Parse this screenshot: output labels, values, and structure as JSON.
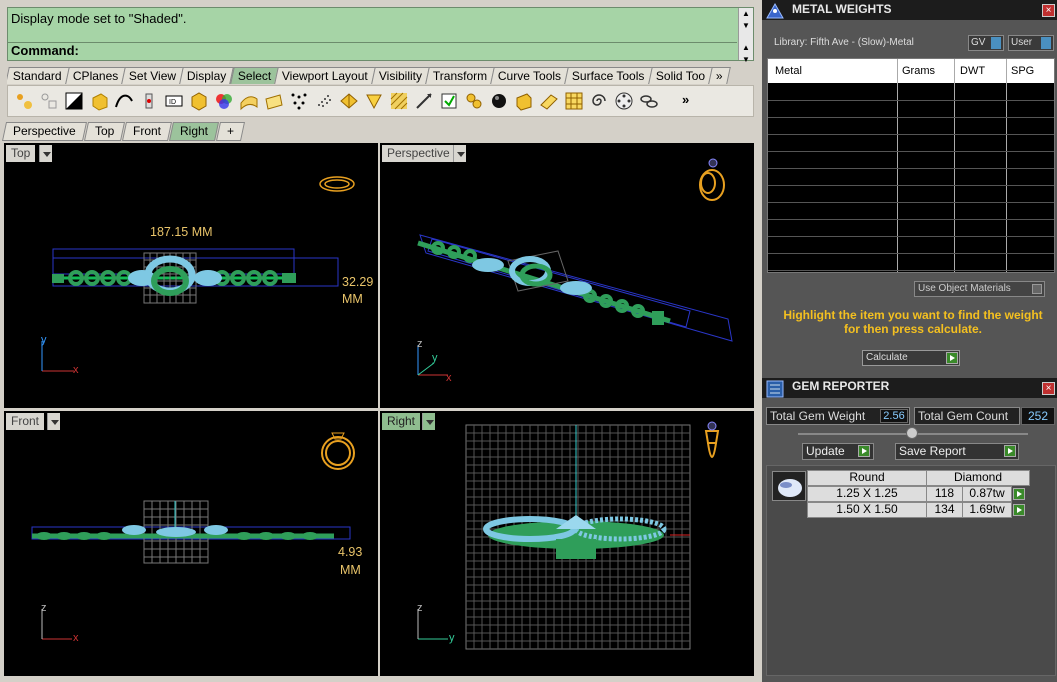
{
  "command": {
    "message": "Display mode set to \"Shaded\".",
    "prompt": "Command:"
  },
  "toolbar_tabs": [
    "Standard",
    "CPlanes",
    "Set View",
    "Display",
    "Select",
    "Viewport Layout",
    "Visibility",
    "Transform",
    "Curve Tools",
    "Surface Tools",
    "Solid Too"
  ],
  "toolbar_more": "»",
  "active_toolbar_tab": "Select",
  "viewport_tabs": [
    "Perspective",
    "Top",
    "Front",
    "Right",
    "+"
  ],
  "active_viewport_tab": "Right",
  "viewports": {
    "top": {
      "label": "Top",
      "dim_width": "187.15 MM",
      "dim_height_value": "32.29",
      "dim_height_unit": "MM",
      "axes": [
        "y",
        "x"
      ]
    },
    "perspective": {
      "label": "Perspective",
      "axes": [
        "z",
        "y",
        "x"
      ]
    },
    "front": {
      "label": "Front",
      "dim_value": "4.93",
      "dim_unit": "MM",
      "axes": [
        "z",
        "x"
      ]
    },
    "right": {
      "label": "Right",
      "axes": [
        "z",
        "y"
      ]
    }
  },
  "metal_weights": {
    "title": "METAL WEIGHTS",
    "library": "Library: Fifth Ave - (Slow)-Metal",
    "gv_label": "GV",
    "user_label": "User",
    "columns": [
      "Metal",
      "Grams",
      "DWT",
      "SPG"
    ],
    "use_object_materials": "Use Object Materials",
    "instruction": "Highlight the item you want to find the weight for then press calculate.",
    "calculate_label": "Calculate"
  },
  "gem_reporter": {
    "title": "GEM REPORTER",
    "total_weight_label": "Total Gem Weight",
    "total_weight": "2.56",
    "total_count_label": "Total Gem Count",
    "total_count": "252",
    "update_label": "Update",
    "save_report_label": "Save Report",
    "shape": "Round",
    "material": "Diamond",
    "rows": [
      {
        "size": "1.25 X 1.25",
        "count": "118",
        "weight": "0.87tw"
      },
      {
        "size": "1.50 X 1.50",
        "count": "134",
        "weight": "1.69tw"
      }
    ]
  },
  "colors": {
    "command_bg": "#a6d4a6",
    "accent_green": "#9cc39c",
    "viewport_bg": "#000000",
    "dimension_yellow": "#e9c46a",
    "panel_bg": "#555555",
    "gem_blue": "#7ec8e3",
    "metal_green": "#2f9e5a",
    "box_blue": "#2a36c8"
  }
}
